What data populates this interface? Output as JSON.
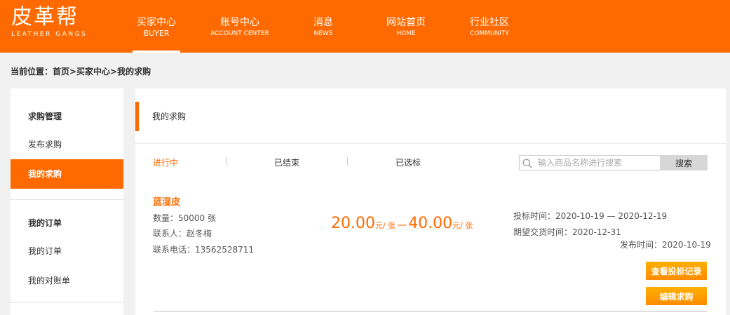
{
  "header": {
    "logo_cn": "皮革帮",
    "logo_en": "LEATHER GANGS",
    "nav": [
      {
        "cn": "买家中心",
        "en": "BUYER"
      },
      {
        "cn": "账号中心",
        "en": "ACCOUNT CENTER"
      },
      {
        "cn": "消息",
        "en": "NEWS"
      },
      {
        "cn": "网站首页",
        "en": "HOME"
      },
      {
        "cn": "行业社区",
        "en": "COMMUNITY"
      }
    ],
    "accent": "#ff6a00"
  },
  "breadcrumb": "当前位置：首页>买家中心>我的求购",
  "sidebar": {
    "group1_title": "求购管理",
    "group1_items": [
      "发布求购",
      "我的求购"
    ],
    "group2_title": "我的订单",
    "group2_items": [
      "我的订单",
      "我的对账单"
    ]
  },
  "main": {
    "title": "我的求购",
    "tabs": [
      "进行中",
      "已结束",
      "已选标"
    ],
    "search": {
      "placeholder": "输入商品名称进行搜索",
      "button": "搜索",
      "icon": "search-icon"
    },
    "item": {
      "name": "蓝湿皮",
      "quantity_label": "数量：",
      "quantity": "50000 张",
      "contact_label": "联系人：",
      "contact": "赵冬梅",
      "phone_label": "联系电话：",
      "phone": "13562528711",
      "price_min": "20.00",
      "price_max": "40.00",
      "price_unit": "元/ 张",
      "price_dash": "—",
      "bid_time_label": "投标时间：",
      "bid_time": "2020-10-19 — 2020-12-19",
      "delivery_label": "期望交货时间：",
      "delivery": "2020-12-31",
      "publish_label": "发布时间：",
      "publish": "2020-10-19",
      "btn_bids": "查看投标记录",
      "btn_edit": "编辑求购"
    }
  }
}
